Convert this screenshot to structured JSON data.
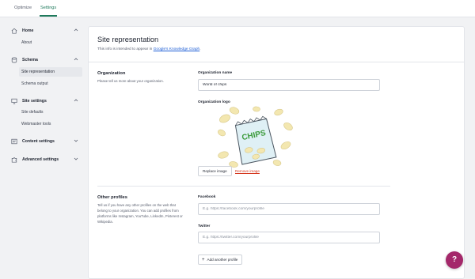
{
  "top_tabs": [
    {
      "label": "Optimize"
    },
    {
      "label": "Settings"
    }
  ],
  "sidebar": {
    "groups": [
      {
        "label": "Home",
        "icon": "home-icon",
        "items": [
          {
            "label": "About"
          }
        ]
      },
      {
        "label": "Schema",
        "icon": "database-icon",
        "items": [
          {
            "label": "Site representation"
          },
          {
            "label": "Schema output"
          }
        ]
      },
      {
        "label": "Site settings",
        "icon": "monitor-icon",
        "items": [
          {
            "label": "Site defaults"
          },
          {
            "label": "Webmaster tools"
          }
        ]
      },
      {
        "label": "Content settings",
        "icon": "sliders-icon",
        "items": []
      },
      {
        "label": "Advanced settings",
        "icon": "puzzle-icon",
        "items": []
      }
    ]
  },
  "page": {
    "title": "Site representation",
    "subtitle_prefix": "This info is intended to appear in ",
    "subtitle_link": "Google's Knowledge Graph",
    "subtitle_suffix": "."
  },
  "organization": {
    "title": "Organization",
    "description": "Please tell us more about your organization.",
    "name_label": "Organization name",
    "name_value": "World of chips",
    "logo_label": "Organization logo",
    "logo_text": "CHIPS",
    "replace_label": "Replace image",
    "remove_label": "Remove image"
  },
  "other_profiles": {
    "title": "Other profiles",
    "description": "Tell us if you have any other profiles on the web that belong to your organization. You can add profiles from platforms like Instagram, YouTube, LinkedIn, Pinterest or Wikipedia.",
    "facebook_label": "Facebook",
    "facebook_placeholder": "E.g. https://facebook.com/yourprofile",
    "twitter_label": "Twitter",
    "twitter_placeholder": "E.g. https://twitter.com/yourprofile",
    "add_label": "Add another profile"
  },
  "help_button": {
    "label": "?"
  },
  "colors": {
    "accent": "#1f7a5c",
    "link": "#1f5fd6",
    "danger": "#d4351c",
    "help": "#a4286a",
    "bag": "#dff0f5",
    "chip": "#f3e7b0",
    "logo_text": "#3a9a3a"
  }
}
